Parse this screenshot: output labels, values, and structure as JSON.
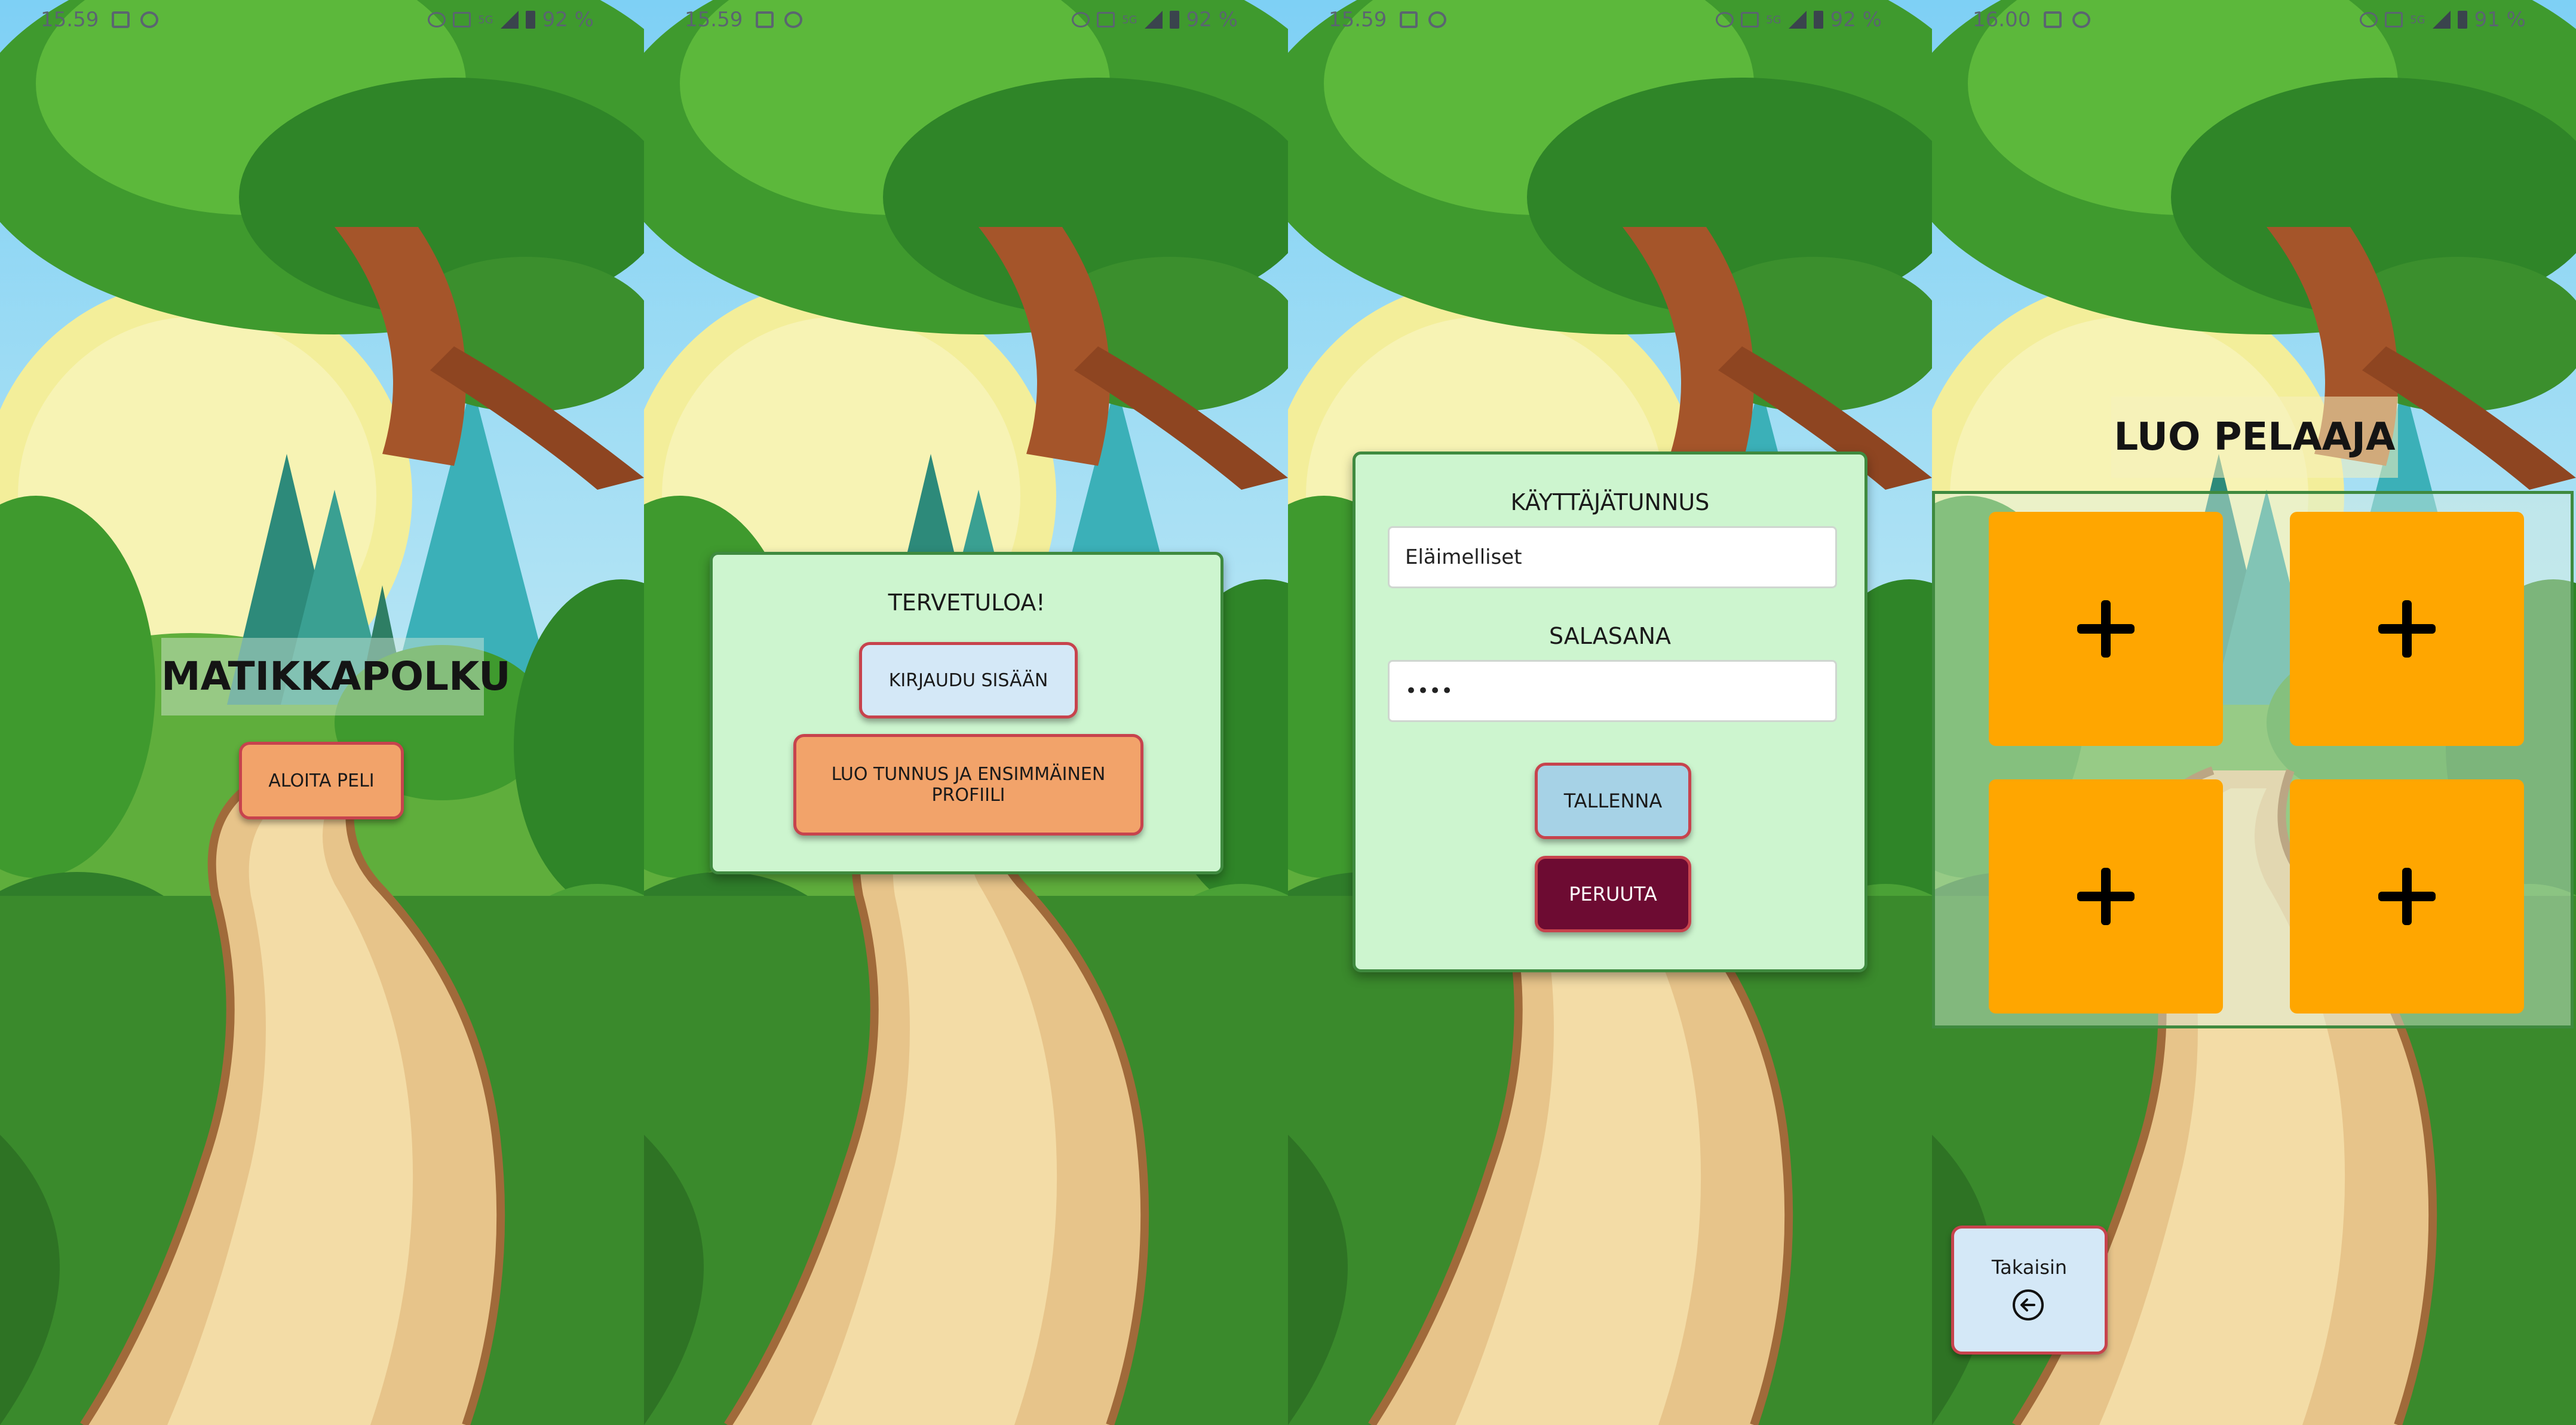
{
  "screens": [
    {
      "status": {
        "time": "15.59",
        "battery": "92 %",
        "network": "5G"
      },
      "title": "MATIKKAPOLKU",
      "start_button": "ALOITA PELI"
    },
    {
      "status": {
        "time": "15.59",
        "battery": "92 %",
        "network": "5G"
      },
      "panel_title": "TERVETULOA!",
      "login_button": "KIRJAUDU SISÄÄN",
      "create_button": "LUO TUNNUS JA ENSIMMÄINEN PROFIILI"
    },
    {
      "status": {
        "time": "15.59",
        "battery": "92 %",
        "network": "5G"
      },
      "username_label": "KÄYTTÄJÄTUNNUS",
      "username_value": "Eläimelliset",
      "password_label": "SALASANA",
      "password_value": "••••",
      "save_button": "TALLENNA",
      "cancel_button": "PERUUTA"
    },
    {
      "status": {
        "time": "16.00",
        "battery": "91 %",
        "network": "5G"
      },
      "title": "LUO PELAAJA",
      "slots": [
        "+",
        "+",
        "+",
        "+"
      ],
      "back_button": "Takaisin"
    }
  ],
  "colors": {
    "panel_bg": "#cdf5cf",
    "panel_border": "#3f8a3f",
    "button_border": "#c7434d",
    "orange_button": "#f2a36a",
    "light_blue_button": "#d4e8f7",
    "sky_blue_button": "#a6d2e6",
    "maroon_button": "#6d0b32",
    "slot_orange": "#ffa600"
  },
  "icons": [
    "image-icon",
    "app-icon",
    "alarm-icon",
    "cast-icon",
    "wifi-calling-icon",
    "signal-icon",
    "battery-icon",
    "back-arrow-icon",
    "plus-icon"
  ]
}
